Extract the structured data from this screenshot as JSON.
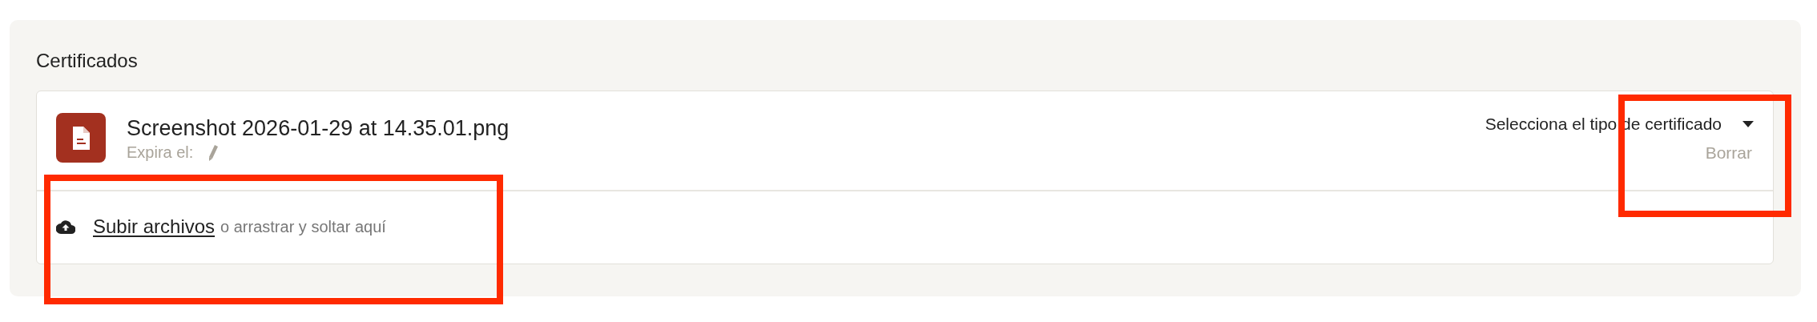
{
  "section": {
    "title": "Certificados"
  },
  "files": [
    {
      "name": "Screenshot 2026-01-29 at 14.35.01.png",
      "expiry_label": "Expira el:",
      "type_select": "Selecciona el tipo de certificado",
      "delete": "Borrar"
    }
  ],
  "upload": {
    "link": "Subir archivos",
    "hint": "o arrastrar y soltar aquí"
  }
}
